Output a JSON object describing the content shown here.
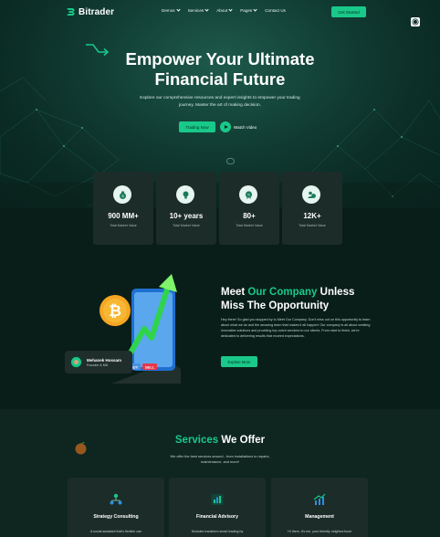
{
  "brand": {
    "name": "Bitrader",
    "accent": "#19c98a"
  },
  "nav": {
    "items": [
      {
        "label": "Demos",
        "dropdown": true
      },
      {
        "label": "Services",
        "dropdown": true
      },
      {
        "label": "About",
        "dropdown": true
      },
      {
        "label": "Pages",
        "dropdown": true
      },
      {
        "label": "Contact Us",
        "dropdown": false
      }
    ],
    "cta": "Get Started"
  },
  "hero": {
    "title_line1": "Empower Your Ultimate",
    "title_line2": "Financial Future",
    "description": "Explore our comprehensive resources and expert insights to empower your trading journey. Master the art of making decision.",
    "primary_button": "Trading Now",
    "video_label": "Watch Video"
  },
  "stats": [
    {
      "value": "900 MM+",
      "label": "Total Market Value",
      "icon": "money-bag-icon"
    },
    {
      "value": "10+ years",
      "label": "Total Market Value",
      "icon": "lightbulb-icon"
    },
    {
      "value": "80+",
      "label": "Total Market Value",
      "icon": "percent-badge-icon"
    },
    {
      "value": "12K+",
      "label": "Total Market Value",
      "icon": "users-icon"
    }
  ],
  "about": {
    "title_prefix": "Meet ",
    "title_accent": "Our Company",
    "title_suffix": " Unless",
    "title_line2": "Miss The Opportunity",
    "description": "Hey there! So glad you stopped by to Meet Our Company. Don't miss out on this opportunity to learn about what we do and the amazing team that makes it all happen! Our company is all about creating innovative solutions and providing top-notch services to our clients. From start to finish, we're dedicated to delivering results that exceed expectations.",
    "button": "Explore More",
    "person": {
      "name": "Mehanek Hossam",
      "role": "Founder & MD"
    },
    "phone_labels": {
      "buy": "BUY",
      "sell": "SELL"
    }
  },
  "services": {
    "title_accent": "Services",
    "title_rest": " We Offer",
    "description": "We offer the best services around - from installations to repairs, maintenance, and more!",
    "cards": [
      {
        "title": "Strategy Consulting",
        "text": "A social assistant that's flexible can",
        "icon": "org-chart-icon"
      },
      {
        "title": "Financial Advisory",
        "text": "Modules transform smart trading by",
        "icon": "bar-chart-icon"
      },
      {
        "title": "Management",
        "text": "Hi there, it's me, your friendly neighborhood",
        "icon": "growth-chart-icon"
      }
    ]
  }
}
